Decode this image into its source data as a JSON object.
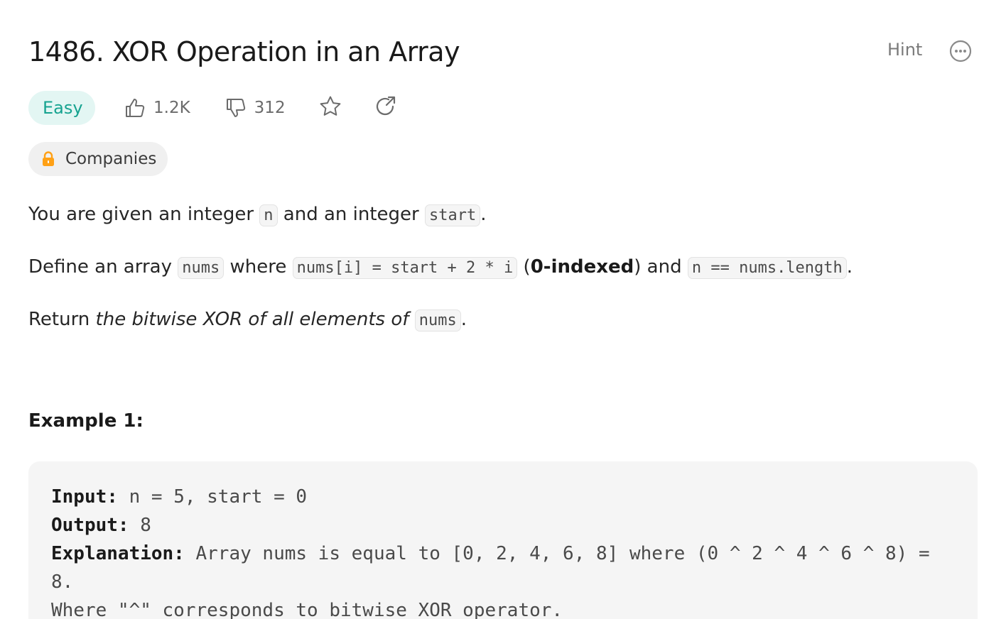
{
  "problem": {
    "title": "1486. XOR Operation in an Array",
    "hint_label": "Hint",
    "difficulty": "Easy",
    "likes": "1.2K",
    "dislikes": "312",
    "companies_label": "Companies"
  },
  "description": {
    "p1": {
      "t1": "You are given an integer ",
      "c1": "n",
      "t2": " and an integer ",
      "c2": "start",
      "t3": "."
    },
    "p2": {
      "t1": "Define an array ",
      "c1": "nums",
      "t2": " where ",
      "c2": "nums[i] = start + 2 * i",
      "t3": " (",
      "b1": "0-indexed",
      "t4": ") and ",
      "c3": "n == nums.length",
      "t5": "."
    },
    "p3": {
      "t1": "Return ",
      "i1": "the bitwise XOR of all elements of",
      "t2": " ",
      "c1": "nums",
      "t3": "."
    }
  },
  "example1": {
    "title": "Example 1:",
    "input_label": "Input:",
    "input_value": " n = 5, start = 0",
    "output_label": "Output:",
    "output_value": " 8",
    "explanation_label": "Explanation:",
    "explanation_value": " Array nums is equal to [0, 2, 4, 6, 8] where (0 ^ 2 ^ 4 ^ 6 ^ 8) = 8.",
    "note": "Where \"^\" corresponds to bitwise XOR operator."
  },
  "colors": {
    "easy_text": "#16a390",
    "easy_bg": "#e3f6f3",
    "lock": "#ffa116"
  },
  "icons": [
    "thumbs-up-icon",
    "thumbs-down-icon",
    "star-icon",
    "share-icon",
    "lock-icon",
    "more-icon"
  ]
}
